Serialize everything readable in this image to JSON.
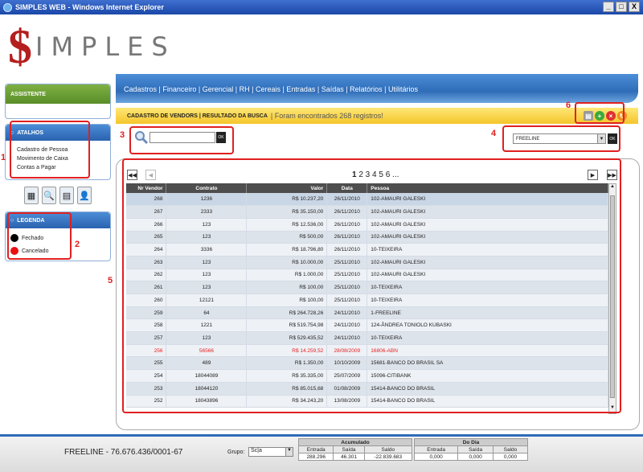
{
  "window": {
    "title": "SIMPLES WEB - Windows Internet Explorer",
    "min": "_",
    "max": "□",
    "close": "X"
  },
  "logo": {
    "symbol": "$",
    "text": "IMPLES"
  },
  "nav": {
    "items": [
      "Cadastros",
      "Financeiro",
      "Gerencial",
      "RH",
      "Cereais",
      "Entradas",
      "Saídas",
      "Relatórios",
      "Utilitários"
    ],
    "separator": " | "
  },
  "sidebar": {
    "assistente": "ASSISTENTE",
    "atalhos": {
      "title": "ATALHOS",
      "items": [
        "Cadastro de Pessoa",
        "Movimento de Caixa",
        "Contas a Pagar"
      ]
    },
    "legenda": {
      "title": "LEGENDA",
      "items": [
        {
          "label": "Fechado",
          "color": "#000000"
        },
        {
          "label": "Cancelado",
          "color": "#e81010"
        }
      ]
    }
  },
  "banner": {
    "title": "CADASTRO DE VENDORS | RESULTADO DA BUSCA",
    "message": "| Foram encontrados 268 registros!"
  },
  "search": {
    "value": "",
    "ok": "OK"
  },
  "filter": {
    "selected": "FREELINE",
    "ok": "OK"
  },
  "pager": {
    "current": "1",
    "others": "2 3 4 5 6 ..."
  },
  "grid": {
    "columns": [
      "Nr Vendor",
      "Contrato",
      "Valor",
      "Data",
      "Pessoa"
    ],
    "rows": [
      [
        "268",
        "1236",
        "R$ 10.237,20",
        "26/11/2010",
        "102-AMAURI GALESKI"
      ],
      [
        "267",
        "2333",
        "R$ 35.150,00",
        "26/11/2010",
        "102-AMAURI GALESKI"
      ],
      [
        "266",
        "123",
        "R$ 12.536,00",
        "26/11/2010",
        "102-AMAURI GALESKI"
      ],
      [
        "265",
        "123",
        "R$ 500,00",
        "26/11/2010",
        "102-AMAURI GALESKI"
      ],
      [
        "264",
        "3336",
        "R$ 18.796,80",
        "26/11/2010",
        "10-TEIXEIRA"
      ],
      [
        "263",
        "123",
        "R$ 10.000,00",
        "25/11/2010",
        "102-AMAURI GALESKI"
      ],
      [
        "262",
        "123",
        "R$ 1.000,00",
        "25/11/2010",
        "102-AMAURI GALESKI"
      ],
      [
        "261",
        "123",
        "R$ 100,00",
        "25/11/2010",
        "10-TEIXEIRA"
      ],
      [
        "260",
        "12121",
        "R$ 100,00",
        "25/11/2010",
        "10-TEIXEIRA"
      ],
      [
        "259",
        "64",
        "R$ 264.728,26",
        "24/11/2010",
        "1-FREELINE"
      ],
      [
        "258",
        "1221",
        "R$ 519.754,98",
        "24/11/2010",
        "124-ÂNDREA TONIOLO KUBASKI"
      ],
      [
        "257",
        "123",
        "R$ 529.435,52",
        "24/11/2010",
        "10-TEIXEIRA"
      ],
      [
        "256",
        "56566",
        "R$ 14.259,52",
        "28/08/2009",
        "16806-ABN"
      ],
      [
        "255",
        "489",
        "R$ 1.350,00",
        "10/10/2009",
        "15681-BANCO DO BRASIL SA"
      ],
      [
        "254",
        "18044089",
        "R$ 35.335,00",
        "25/07/2009",
        "15096-CITIBANK"
      ],
      [
        "253",
        "18044120",
        "R$ 85.015,68",
        "01/08/2009",
        "15414-BANCO DO BRASIL"
      ],
      [
        "252",
        "18043896",
        "R$ 34.243,20",
        "13/08/2009",
        "15414-BANCO DO BRASIL"
      ]
    ],
    "cancelled_row": "256"
  },
  "annotations": [
    "1",
    "2",
    "3",
    "4",
    "5",
    "6"
  ],
  "footer": {
    "company": "FREELINE - 76.676.436/0001-67",
    "grupo_label": "Grupo:",
    "grupo_value": "Sc|a",
    "acumulado": {
      "title": "Acumulado",
      "headers": [
        "Entrada",
        "Saída",
        "Saldo"
      ],
      "values": [
        "288.296",
        "46.301",
        "-22.839.683"
      ]
    },
    "dodia": {
      "title": "Do Dia",
      "headers": [
        "Entrada",
        "Saída",
        "Saldo"
      ],
      "values": [
        "0,000",
        "0,000",
        "0,000"
      ]
    }
  }
}
